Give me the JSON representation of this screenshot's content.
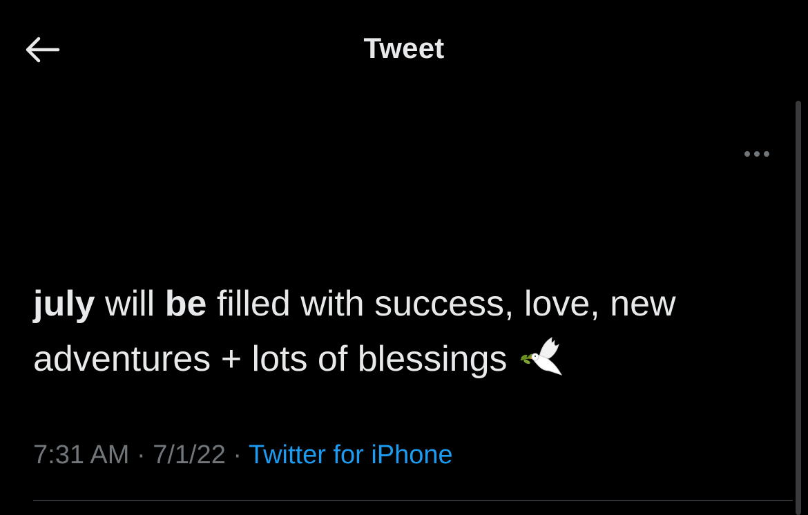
{
  "header": {
    "title": "Tweet",
    "back_icon": "arrow-left-icon"
  },
  "more_icon": "more-horizontal-icon",
  "tweet": {
    "text_parts": [
      {
        "text": "july",
        "bold": true
      },
      {
        "text": " will ",
        "bold": false
      },
      {
        "text": "be",
        "bold": true
      },
      {
        "text": " filled with success, love, new adventures + lots of blessings",
        "bold": false
      }
    ],
    "emoji": "dove-icon",
    "time": "7:31 AM",
    "separator": "·",
    "date": "7/1/22",
    "source": "Twitter for iPhone"
  },
  "colors": {
    "background": "#000000",
    "text": "#e7e9ea",
    "secondary": "#71767b",
    "link": "#1d9bf0"
  }
}
